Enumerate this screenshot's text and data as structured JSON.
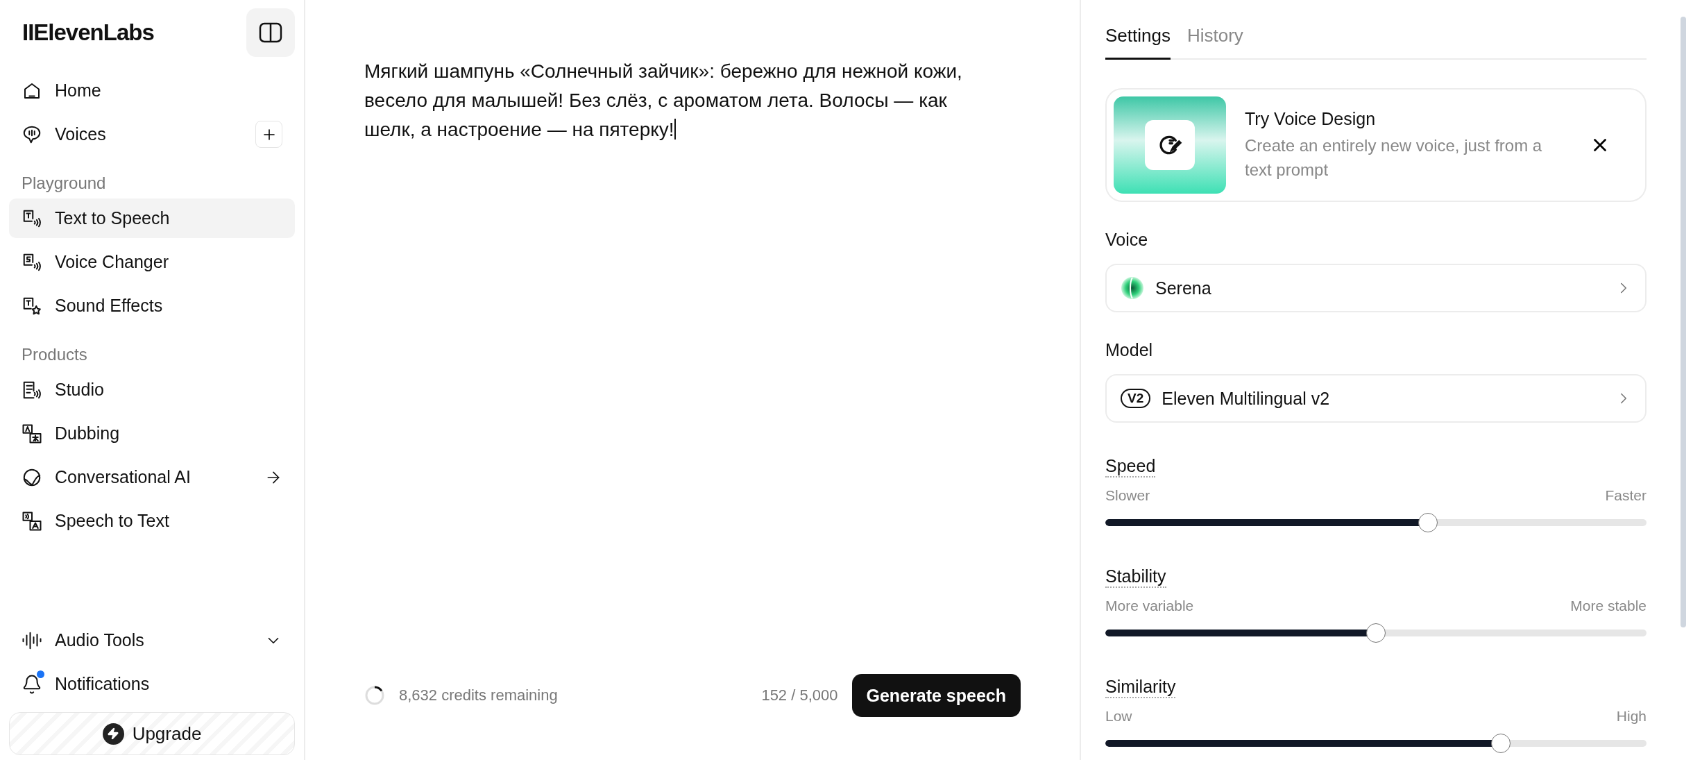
{
  "sidebar": {
    "logo": "IIElevenLabs",
    "sections": [
      {
        "items": [
          {
            "label": "Home",
            "kind": "plain",
            "selected": false
          },
          {
            "label": "Voices",
            "kind": "add",
            "selected": false
          }
        ]
      },
      {
        "title": "Playground",
        "items": [
          {
            "label": "Text to Speech",
            "kind": "plain",
            "selected": true
          },
          {
            "label": "Voice Changer",
            "kind": "plain",
            "selected": false
          },
          {
            "label": "Sound Effects",
            "kind": "plain",
            "selected": false
          }
        ]
      },
      {
        "title": "Products",
        "items": [
          {
            "label": "Studio",
            "kind": "plain",
            "selected": false
          },
          {
            "label": "Dubbing",
            "kind": "plain",
            "selected": false
          },
          {
            "label": "Conversational AI",
            "kind": "link",
            "selected": false
          },
          {
            "label": "Speech to Text",
            "kind": "plain",
            "selected": false
          }
        ]
      }
    ],
    "bottom_items": [
      {
        "label": "Audio Tools",
        "kind": "expand",
        "expanded": false
      },
      {
        "label": "Notifications",
        "kind": "notify",
        "unread": true
      }
    ],
    "upgrade": "Upgrade"
  },
  "editor": {
    "text": "Мягкий шампунь «Солнечный зайчик»: бережно для нежной кожи, весело для малышей! Без слёз, с ароматом лета. Волосы — как шелк, а настроение — на пятерку!",
    "credits": "8,632 credits remaining",
    "char_count": "152 / 5,000",
    "generate_button": "Generate speech"
  },
  "settings": {
    "tabs": [
      {
        "label": "Settings",
        "selected": true
      },
      {
        "label": "History",
        "selected": false
      }
    ],
    "promo": {
      "title": "Try Voice Design",
      "description": "Create an entirely new voice, just from a text prompt"
    },
    "fields": [
      {
        "label": "Voice",
        "kind": "voice",
        "value": "Serena"
      },
      {
        "label": "Model",
        "kind": "model",
        "badge": "V2",
        "value": "Eleven Multilingual v2"
      }
    ],
    "sliders": [
      {
        "label": "Speed",
        "min_label": "Slower",
        "max_label": "Faster",
        "level": 0.6
      },
      {
        "label": "Stability",
        "min_label": "More variable",
        "max_label": "More stable",
        "level": 0.5
      },
      {
        "label": "Similarity",
        "min_label": "Low",
        "max_label": "High",
        "level": 0.74
      }
    ]
  }
}
